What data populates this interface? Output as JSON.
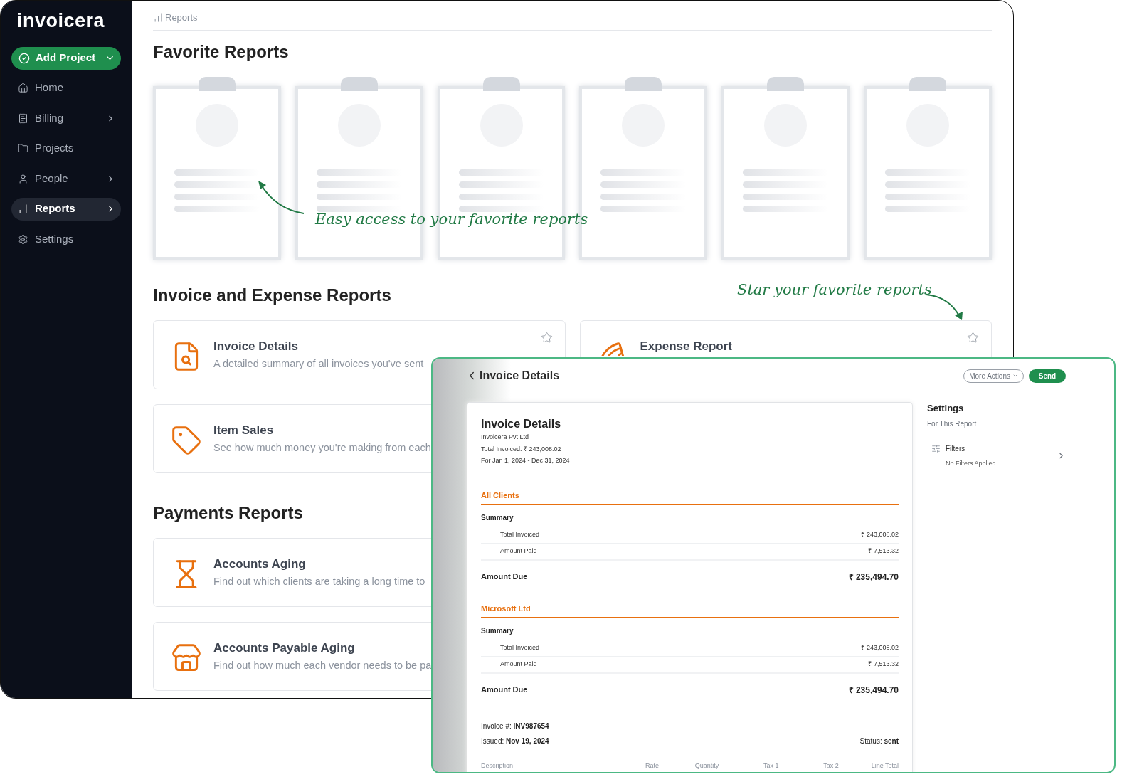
{
  "brand": {
    "logo": "invoicera"
  },
  "sidebar": {
    "add_button": "Add Project",
    "items": [
      {
        "label": "Home",
        "submenu": false,
        "selected": false
      },
      {
        "label": "Billing",
        "submenu": true,
        "selected": false
      },
      {
        "label": "Projects",
        "submenu": false,
        "selected": false
      },
      {
        "label": "People",
        "submenu": true,
        "selected": false
      },
      {
        "label": "Reports",
        "submenu": true,
        "selected": true
      },
      {
        "label": "Settings",
        "submenu": false,
        "selected": false
      }
    ]
  },
  "breadcrumb": "Reports",
  "favorites": {
    "title": "Favorite Reports"
  },
  "annotations": [
    "Easy access to your favorite reports",
    "Star your favorite reports"
  ],
  "sections": [
    {
      "title": "Invoice and Expense Reports",
      "reports": [
        {
          "title": "Invoice Details",
          "description": "A detailed summary of all invoices you've sent",
          "starred": false
        },
        {
          "title": "Expense Report",
          "starred": false
        },
        {
          "title": "Item Sales",
          "description": "See how much money you're making from each"
        }
      ]
    },
    {
      "title": "Payments Reports",
      "reports": [
        {
          "title": "Accounts Aging",
          "description": "Find out which clients are taking a long time to"
        },
        {
          "title": "Accounts Payable Aging",
          "description": "Find out how much each vendor needs to be pa"
        }
      ]
    }
  ],
  "detail": {
    "title": "Invoice Details",
    "more_button": "More Actions",
    "send_button": "Send",
    "report": {
      "title": "Invoice Details",
      "company": "Invoicera Pvt Ltd",
      "total": "Total Invoiced: ₹ 243,008.02",
      "period": "For Jan 1, 2024 - Dec 31, 2024",
      "groups": [
        {
          "name": "All Clients",
          "summary": "Summary",
          "rows": [
            {
              "label": "Total Invoiced",
              "value": "₹ 243,008.02"
            },
            {
              "label": "Amount Paid",
              "value": "₹ 7,513.32"
            }
          ],
          "due_label": "Amount Due",
          "due_value": "₹ 235,494.70"
        },
        {
          "name": "Microsoft Ltd",
          "summary": "Summary",
          "rows": [
            {
              "label": "Total Invoiced",
              "value": "₹ 243,008.02"
            },
            {
              "label": "Amount Paid",
              "value": "₹ 7,513.32"
            }
          ],
          "due_label": "Amount Due",
          "due_value": "₹ 235,494.70"
        }
      ],
      "invoice_number": "Invoice #: **INV987654**",
      "issued": "Issued: **Nov 19, 2024**",
      "status": "Status: **sent**",
      "columns": [
        "Description",
        "Rate",
        "Quantity",
        "Tax 1",
        "Tax 2",
        "Line Total"
      ]
    },
    "settings": {
      "title": "Settings",
      "subtitle": "For This Report",
      "filter_label": "Filters",
      "filter_value": "No Filters Applied"
    }
  }
}
